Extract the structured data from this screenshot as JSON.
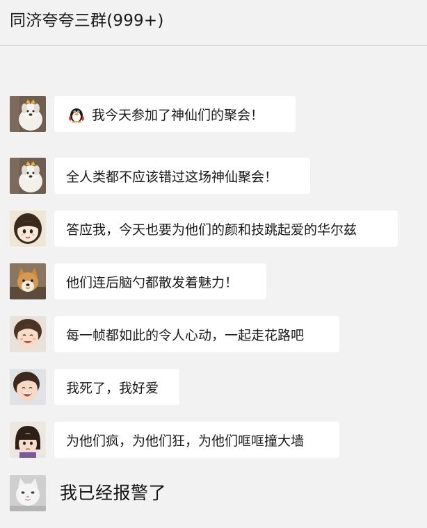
{
  "chat": {
    "title": "同济夸夸三群(999+)"
  },
  "messages": [
    {
      "avatar": "puppy-crown-avatar",
      "text": "我今天参加了神仙们的聚会！",
      "emoji": "penguin-emoji"
    },
    {
      "avatar": "puppy-crown-avatar",
      "text": "全人类都不应该错过这场神仙聚会！"
    },
    {
      "avatar": "anime-girl-avatar",
      "text": "答应我，今天也要为他们的颜和技跳起爱的华尔兹"
    },
    {
      "avatar": "shiba-dog-avatar",
      "text": "他们连后脑勺都散发着魅力！"
    },
    {
      "avatar": "smiling-child-avatar",
      "text": "每一帧都如此的令人心动，一起走花路吧"
    },
    {
      "avatar": "laughing-child-avatar",
      "text": "我死了，我好爱"
    },
    {
      "avatar": "bob-haircut-child-avatar",
      "text": "为他们疯，为他们狂，为他们哐哐撞大墙"
    },
    {
      "avatar": "cat-avatar",
      "text": "我已经报警了"
    }
  ],
  "colors": {
    "background": "#f2f2f2",
    "bubble": "#ffffff",
    "text": "#1a1a1a"
  }
}
